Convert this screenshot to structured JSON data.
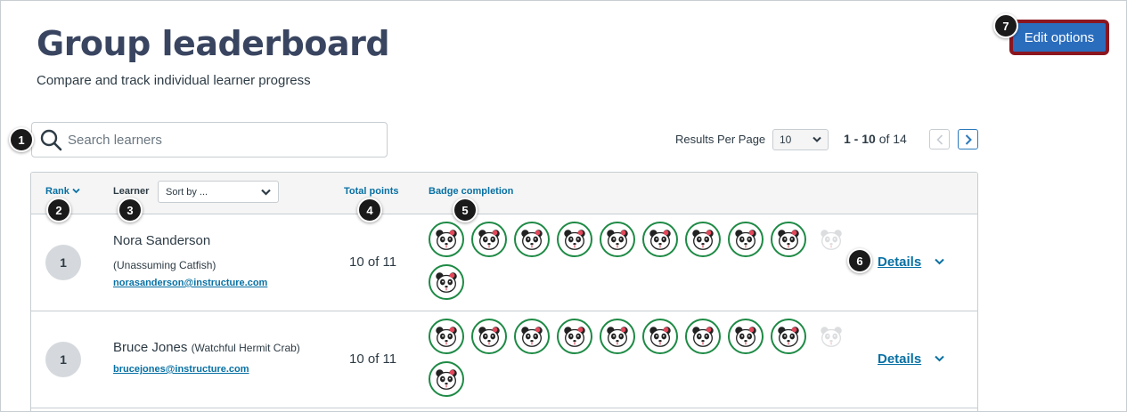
{
  "header": {
    "title": "Group leaderboard",
    "subtitle": "Compare and track individual learner progress",
    "edit_button": "Edit options"
  },
  "search": {
    "placeholder": "Search learners"
  },
  "pagination": {
    "rpp_label": "Results Per Page",
    "rpp_value": "10",
    "range": "1 - 10",
    "of_text": "of 14"
  },
  "table": {
    "headers": {
      "rank": "Rank",
      "learner": "Learner",
      "sort_placeholder": "Sort by ...",
      "points": "Total points",
      "badges": "Badge completion"
    },
    "rows": [
      {
        "rank": "1",
        "name": "Nora Sanderson",
        "nickname": "(Unassuming Catfish)",
        "email": "norasanderson@instructure.com",
        "points": "10 of 11",
        "earned_badges": 10,
        "total_badges": 11,
        "details": "Details"
      },
      {
        "rank": "1",
        "name": "Bruce Jones",
        "nickname": "(Watchful Hermit Crab)",
        "email": "brucejones@instructure.com",
        "points": "10 of 11",
        "earned_badges": 10,
        "total_badges": 11,
        "details": "Details"
      }
    ]
  },
  "callouts": [
    "1",
    "2",
    "3",
    "4",
    "5",
    "6",
    "7"
  ],
  "colors": {
    "accent": "#2b6dbd",
    "link": "#0770a3",
    "badge_border": "#1e8a45",
    "highlight_border": "#8b1620"
  }
}
